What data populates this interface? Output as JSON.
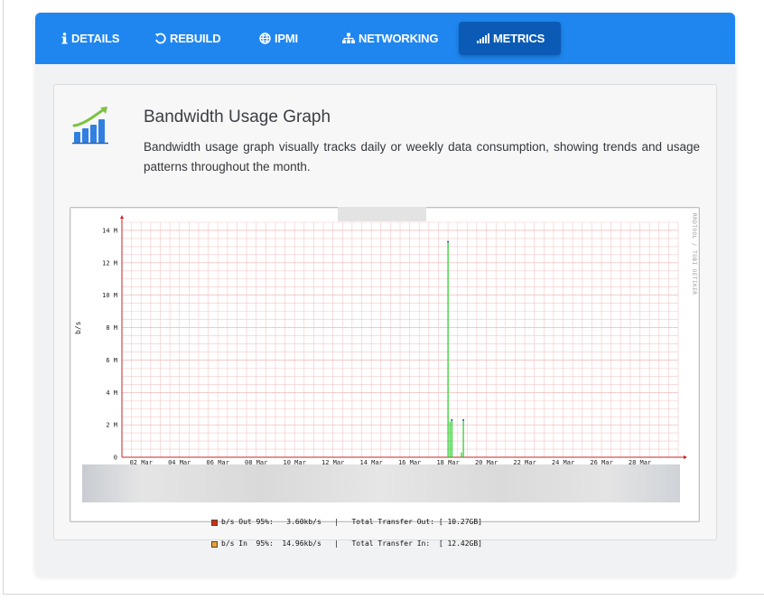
{
  "tabs": [
    {
      "label": "DETAILS",
      "icon": "info-icon"
    },
    {
      "label": "REBUILD",
      "icon": "rebuild-icon"
    },
    {
      "label": "IPMI",
      "icon": "globe-icon"
    },
    {
      "label": "NETWORKING",
      "icon": "network-icon"
    },
    {
      "label": "METRICS",
      "icon": "bar-chart-icon",
      "active": true
    }
  ],
  "panel": {
    "icon": "growth-chart-icon",
    "title": "Bandwidth Usage Graph",
    "description": "Bandwidth usage graph visually tracks daily or weekly data consumption, showing trends and usage patterns throughout the month."
  },
  "graph": {
    "ylabel": "b/s",
    "side_text": "RRDTOOL / TOBI OETIKER",
    "legend": [
      {
        "swatch": "#d42d0a",
        "text": "b/s Out 95%:   3.60kb/s   |   Total Transfer Out: [ 10.27GB]"
      },
      {
        "swatch": "#f0a030",
        "text": "b/s In  95%:  14.96kb/s   |   Total Transfer In:  [ 12.42GB]"
      }
    ]
  },
  "chart_data": {
    "type": "area",
    "ylabel": "b/s",
    "y_ticks": [
      "0",
      "2 M",
      "4 M",
      "6 M",
      "8 M",
      "10 M",
      "12 M",
      "14 M"
    ],
    "y_tick_values": [
      0,
      2000000,
      4000000,
      6000000,
      8000000,
      10000000,
      12000000,
      14000000
    ],
    "x_ticks": [
      "02 Mar",
      "04 Mar",
      "06 Mar",
      "08 Mar",
      "10 Mar",
      "12 Mar",
      "14 Mar",
      "16 Mar",
      "18 Mar",
      "20 Mar",
      "22 Mar",
      "24 Mar",
      "26 Mar",
      "28 Mar"
    ],
    "x_tick_days": [
      2,
      4,
      6,
      8,
      10,
      12,
      14,
      16,
      18,
      20,
      22,
      24,
      26,
      28
    ],
    "xlim_days": [
      1,
      30
    ],
    "ylim": [
      0,
      14500000
    ],
    "grid": true,
    "series": [
      {
        "name": "In",
        "color": "#22cc22",
        "points": [
          {
            "day": 18.0,
            "value": 13300000
          },
          {
            "day": 18.1,
            "value": 2200000
          },
          {
            "day": 18.2,
            "value": 2300000
          },
          {
            "day": 18.7,
            "value": 300000
          },
          {
            "day": 18.8,
            "value": 2300000
          }
        ]
      },
      {
        "name": "Out",
        "color": "#1030d0",
        "points": [
          {
            "day": 18.0,
            "value": 13300000
          },
          {
            "day": 18.2,
            "value": 2300000
          },
          {
            "day": 18.8,
            "value": 2300000
          }
        ]
      }
    ],
    "colors": {
      "background_grid": "#f4c8c8",
      "axis": "#cc2222"
    }
  }
}
